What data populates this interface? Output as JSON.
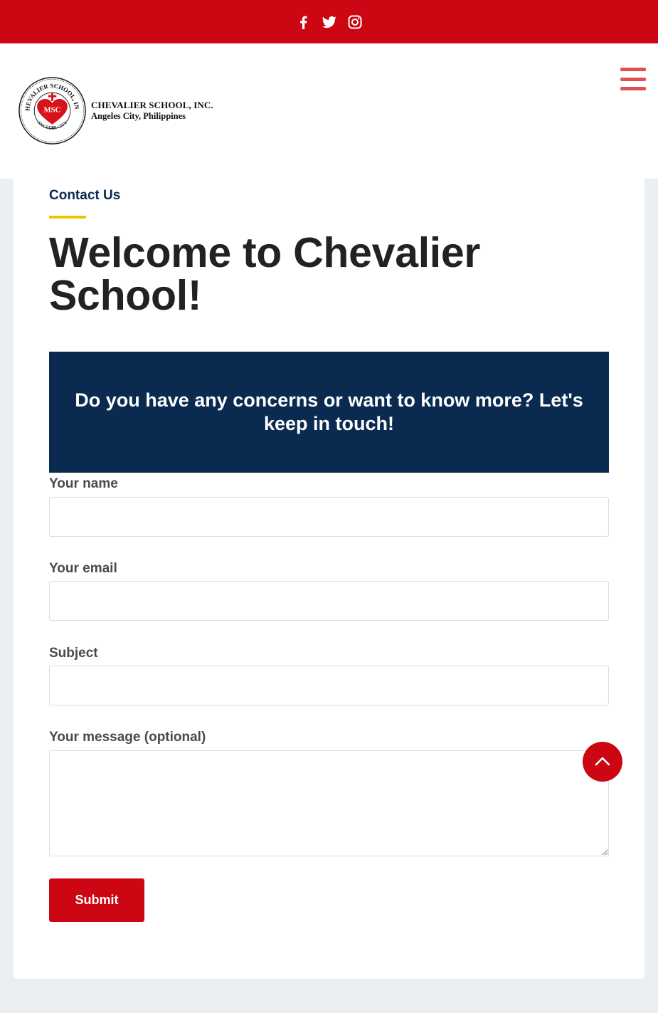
{
  "topbar": {
    "socials": [
      {
        "icon": "facebook-icon"
      },
      {
        "icon": "twitter-icon"
      },
      {
        "icon": "instagram-icon"
      }
    ]
  },
  "header": {
    "logo": {
      "name": "CHEVALIER SCHOOL, INC.",
      "location": "Angeles City, Philippines",
      "seal_text_top": "CHEVALIER SCHOOL, INC.",
      "seal_text_bottom": "ANGELES CITY",
      "seal_monogram": "MSC",
      "seal_year": "1960"
    },
    "menu_icon": "hamburger-menu-icon"
  },
  "page": {
    "eyebrow": "Contact Us",
    "title": "Welcome to Chevalier School!",
    "banner": "Do you have any concerns or want to know more? Let's keep in touch!"
  },
  "form": {
    "name_label": "Your name",
    "email_label": "Your email",
    "subject_label": "Subject",
    "message_label": "Your message (optional)",
    "name_value": "",
    "email_value": "",
    "subject_value": "",
    "message_value": "",
    "submit_label": "Submit"
  },
  "scroll_top_icon": "chevron-up-icon",
  "colors": {
    "brand_red": "#cc0612",
    "navy": "#0a2a4f",
    "accent_yellow": "#f2c200",
    "menu_red": "#e05050",
    "page_bg": "#eceff2"
  }
}
